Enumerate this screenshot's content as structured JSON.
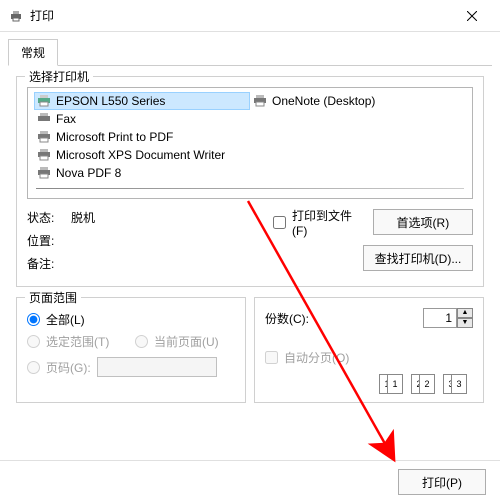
{
  "title": "打印",
  "tab": {
    "label": "常规"
  },
  "printers": {
    "legend": "选择打印机",
    "items": [
      "EPSON L550 Series",
      "Fax",
      "Microsoft Print to PDF",
      "Microsoft XPS Document Writer",
      "Nova PDF 8"
    ],
    "items_col2": [
      "OneNote (Desktop)"
    ]
  },
  "status": {
    "state_k": "状态:",
    "state_v": "脱机",
    "loc_k": "位置:",
    "loc_v": "",
    "comment_k": "备注:",
    "comment_v": ""
  },
  "to_file": "打印到文件(F)",
  "prefs_btn": "首选项(R)",
  "find_btn": "查找打印机(D)...",
  "range": {
    "legend": "页面范围",
    "all": "全部(L)",
    "selection": "选定范围(T)",
    "current": "当前页面(U)",
    "pages": "页码(G):"
  },
  "copies": {
    "count_label": "份数(C):",
    "count_value": "1",
    "collate": "自动分页(O)"
  },
  "footer": {
    "print": "打印(P)"
  }
}
